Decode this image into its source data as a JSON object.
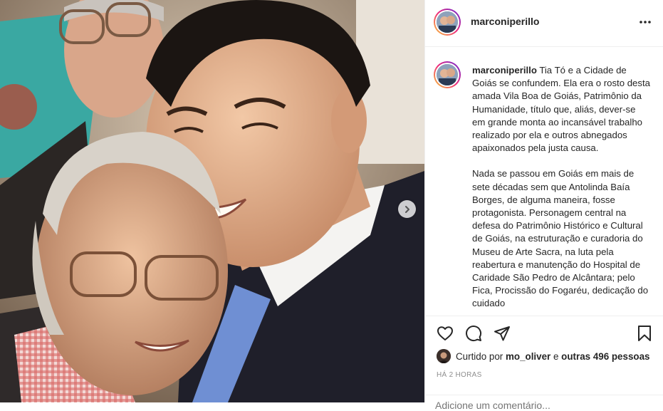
{
  "post": {
    "username": "marconiperillo",
    "more_icon": "more-horizontal-icon"
  },
  "caption": {
    "username": "marconiperillo",
    "paragraph1": "Tia Tó e a Cidade de Goiás se confundem. Ela era o rosto desta amada Vila Boa de Goiás, Patrimônio da Humanidade, título que, aliás, dever-se em grande monta ao incansável trabalho realizado por ela e outros abnegados apaixonados pela justa causa.",
    "paragraph2": "Nada se passou em Goiás em mais de sete décadas sem que Antolinda Baía Borges, de alguma maneira, fosse protagonista. Personagem central na defesa do Patrimônio Histórico e Cultural de Goiás, na estruturação e curadoria do Museu de Arte Sacra, na luta pela reabertura e manutenção do Hospital de Caridade São Pedro de Alcântara; pelo Fica, Procissão do Fogaréu, dedicação do cuidado"
  },
  "actions": {
    "icons": [
      "heart-icon",
      "comment-icon",
      "share-icon",
      "bookmark-icon"
    ]
  },
  "likes": {
    "prefix": "Curtido por",
    "user": "mo_oliver",
    "middle": "e",
    "others": "outras 496 pessoas"
  },
  "timestamp": "HÁ 2 HORAS",
  "comment": {
    "placeholder": "Adicione um comentário..."
  },
  "colors": {
    "text": "#262626",
    "muted": "#8e8e8e",
    "divider": "#efefef"
  }
}
